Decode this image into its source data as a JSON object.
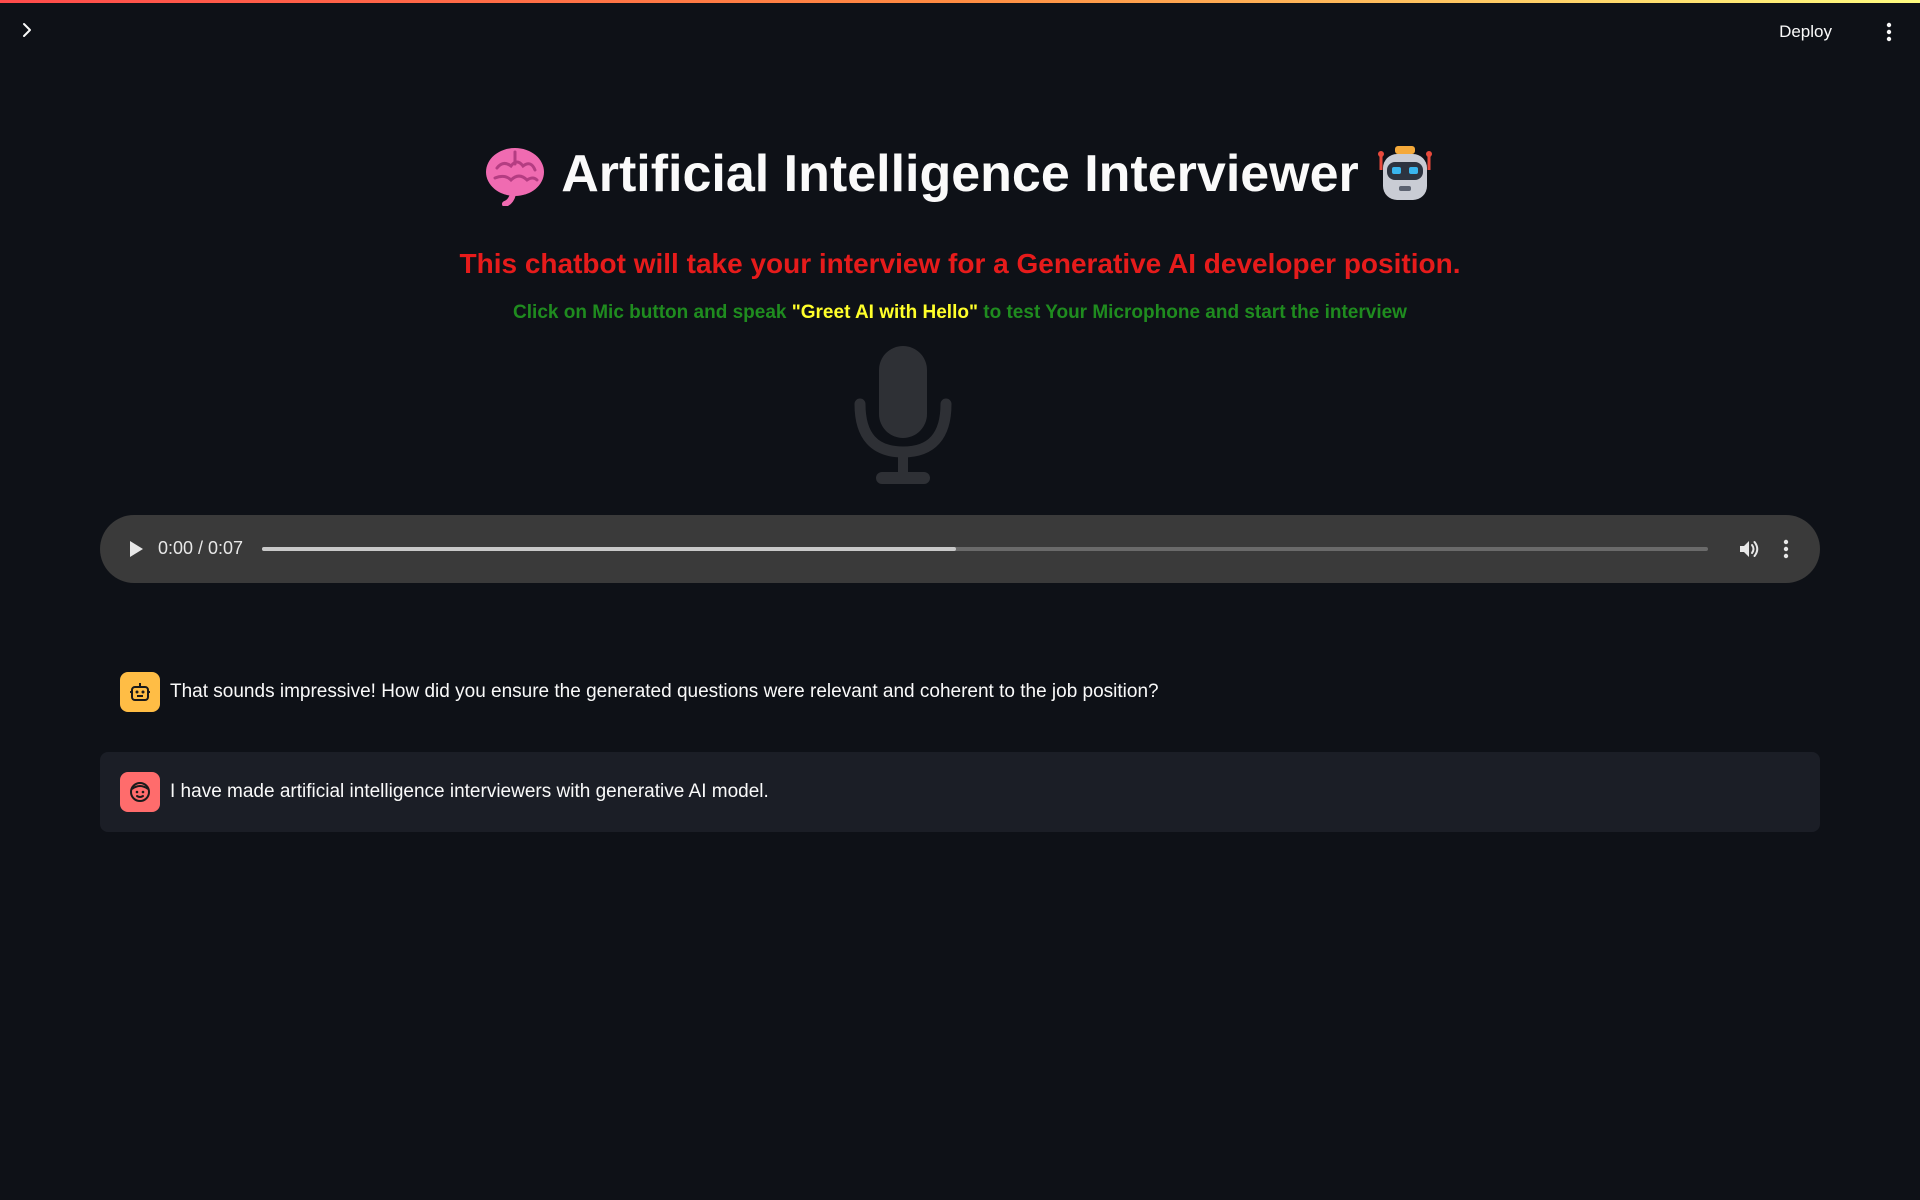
{
  "header": {
    "deploy_label": "Deploy"
  },
  "main": {
    "title": "Artificial Intelligence Interviewer",
    "title_icons": [
      "brain-icon",
      "robot-icon"
    ],
    "subtitle": "This chatbot will take your interview for a Generative AI developer position.",
    "instruction_prefix": "Click on Mic button and speak",
    "instruction_highlight": "\"Greet AI with Hello\"",
    "instruction_suffix": "to test Your Microphone and start the interview"
  },
  "audio": {
    "time": "0:00 / 0:07",
    "progress": 0.48
  },
  "chat": [
    {
      "role": "assistant",
      "avatar_icon": "bot-icon",
      "text": "That sounds impressive! How did you ensure the generated questions were relevant and coherent to the job position?"
    },
    {
      "role": "user",
      "avatar_icon": "user-face-icon",
      "text": "I have made artificial intelligence interviewers with generative AI model."
    }
  ],
  "colors": {
    "background": "#0e1117",
    "subtitle": "#e61b1b",
    "instruction": "#1f8c1f",
    "highlight": "#ffff2a",
    "ai_avatar": "#ffbd45",
    "user_avatar": "#ff6c6c"
  }
}
